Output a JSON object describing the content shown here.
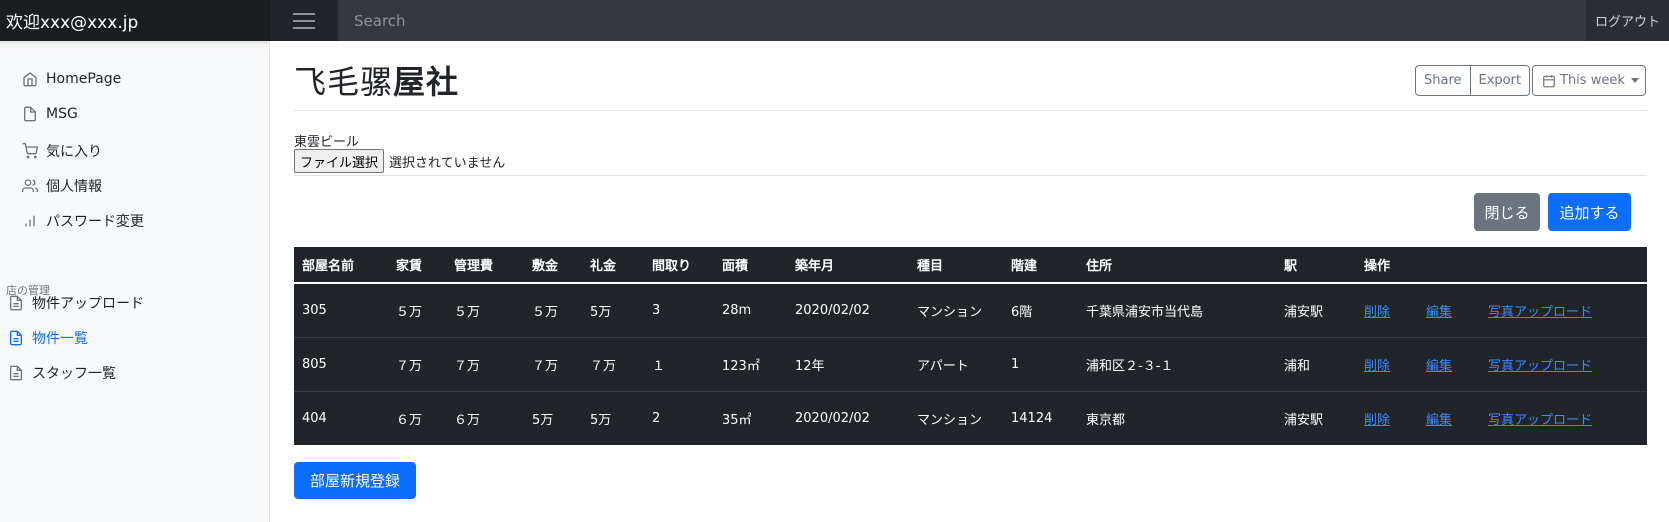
{
  "header": {
    "brand": "欢迎xxx@xxx.jp",
    "search_placeholder": "Search",
    "logout": "ログアウト"
  },
  "sidebar": {
    "items": [
      {
        "label": "HomePage",
        "icon": "home-icon"
      },
      {
        "label": "MSG",
        "icon": "file-icon"
      },
      {
        "label": "気に入り",
        "icon": "cart-icon"
      },
      {
        "label": "個人情報",
        "icon": "users-icon"
      },
      {
        "label": "パスワード変更",
        "icon": "bar-chart-icon"
      }
    ],
    "section_heading": "店の管理",
    "section_items": [
      {
        "label": "物件アップロード",
        "icon": "file-text-icon"
      },
      {
        "label": "物件一覧",
        "icon": "file-text-icon",
        "active": true
      },
      {
        "label": "スタッフ一覧",
        "icon": "file-text-icon"
      }
    ]
  },
  "main": {
    "title_prefix": "飞毛骡",
    "title_bold": "屋社",
    "share": "Share",
    "export": "Export",
    "this_week": "This week",
    "file_label": "東雲ビール",
    "file_button": "ファイル選択",
    "file_status": "選択されていません",
    "close_button": "閉じる",
    "add_button": "追加する",
    "register_button": "部屋新規登録"
  },
  "table": {
    "headers": [
      "部屋名前",
      "家賃",
      "管理費",
      "敷金",
      "礼金",
      "間取り",
      "面積",
      "築年月",
      "種目",
      "階建",
      "住所",
      "駅",
      "操作",
      "",
      ""
    ],
    "rows": [
      [
        "305",
        "５万",
        "５万",
        "５万",
        "5万",
        "3",
        "28m",
        "2020/02/02",
        "マンション",
        "6階",
        "千葉県浦安市当代島",
        "浦安駅",
        "削除",
        "編集",
        "写真アップロード"
      ],
      [
        "805",
        "７万",
        "７万",
        "７万",
        "７万",
        "１",
        "123㎡",
        "12年",
        "アパート",
        "1",
        "浦和区２‐３‐１",
        "浦和",
        "削除",
        "編集",
        "写真アップロード"
      ],
      [
        "404",
        "６万",
        "６万",
        "5万",
        "5万",
        "2",
        "35㎡",
        "2020/02/02",
        "マンション",
        "14124",
        "東京都",
        "浦安駅",
        "削除",
        "編集",
        "写真アップロード"
      ]
    ]
  },
  "colors": {
    "primary": "#0d6efd",
    "secondary": "#6c757d",
    "dark": "#212529",
    "link": "#3a8bff"
  }
}
